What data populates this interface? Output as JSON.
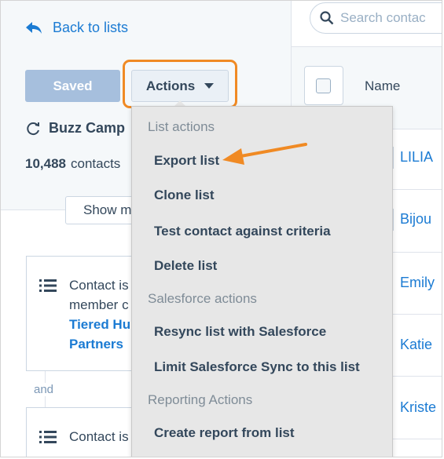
{
  "left": {
    "back_label": "Back to lists",
    "saved_label": "Saved",
    "actions_label": "Actions",
    "list_name": "Buzz Camp",
    "count_value": "10,488",
    "count_suffix": "contacts",
    "show_label": "Show m",
    "criteria": [
      {
        "line1": "Contact is",
        "line2": "member c",
        "link1": "Tiered Hu",
        "link2": "Partners"
      },
      {
        "line1": "Contact is"
      }
    ],
    "and_label": "and"
  },
  "right": {
    "search_placeholder": "Search contac",
    "column_name": "Name",
    "rows": [
      "LILIA",
      "Bijou",
      "Emily",
      "Katie",
      "Kriste"
    ]
  },
  "menu": {
    "heading_list": "List actions",
    "export": "Export list",
    "clone": "Clone list",
    "test": "Test contact against criteria",
    "delete": "Delete list",
    "heading_salesforce": "Salesforce actions",
    "resync": "Resync list with Salesforce",
    "limit": "Limit Salesforce Sync to this list",
    "heading_reporting": "Reporting Actions",
    "report": "Create report from list"
  },
  "colors": {
    "accent_link": "#1b7bd3",
    "highlight": "#f08a24",
    "menu_bg": "#e7e7e7"
  }
}
